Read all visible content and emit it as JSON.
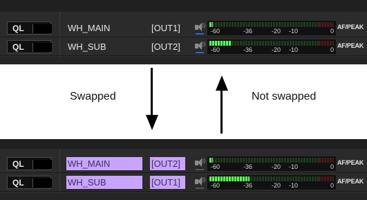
{
  "before_panel": {
    "rows": [
      {
        "ql": "QL",
        "name": "WH_MAIN",
        "out": "[OUT1]",
        "level": 0.03,
        "peak_label": "AF/PEAK"
      },
      {
        "ql": "QL",
        "name": "WH_SUB",
        "out": "[OUT2]",
        "level": 0.18,
        "peak_label": "AF/PEAK"
      }
    ]
  },
  "after_panel": {
    "rows": [
      {
        "ql": "QL",
        "name": "WH_MAIN",
        "out": "[OUT2]",
        "level": 0.03,
        "peak_label": "AF/PEAK"
      },
      {
        "ql": "QL",
        "name": "WH_SUB",
        "out": "[OUT1]",
        "level": 0.32,
        "peak_label": "AF/PEAK"
      }
    ]
  },
  "meter_scale": [
    "-60",
    "-36",
    "-20",
    "-10",
    "0"
  ],
  "captions": {
    "swapped": "Swapped",
    "not_swapped": "Not swapped"
  },
  "colors": {
    "highlight": "#c9a4ff",
    "meter_green": "#5dff5d",
    "panel_bg": "#2b2b2b"
  }
}
